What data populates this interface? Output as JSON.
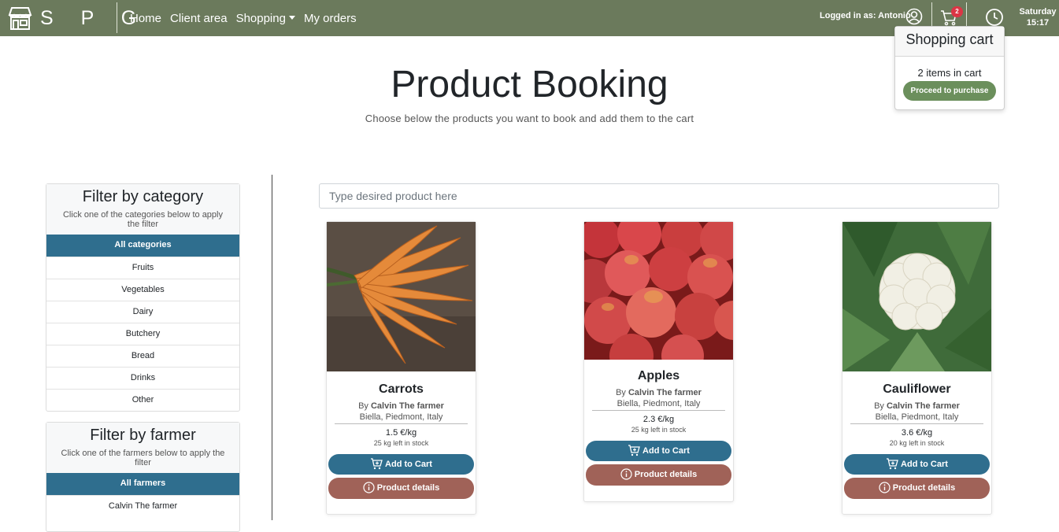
{
  "navbar": {
    "brand": "S P G",
    "links": [
      "Home",
      "Client area",
      "Shopping",
      "My orders"
    ],
    "logged_in": "Logged in as: Antonio",
    "cart_count": "2",
    "day": "Saturday",
    "time": "15:17"
  },
  "cart_popover": {
    "title": "Shopping cart",
    "count_text": "2 items in cart",
    "proceed_label": "Proceed to purchase"
  },
  "header": {
    "title": "Product Booking",
    "subtitle": "Choose below the products you want to book and add them to the cart"
  },
  "category_filter": {
    "title": "Filter by category",
    "hint": "Click one of the categories below to apply the filter",
    "items": [
      "All categories",
      "Fruits",
      "Vegetables",
      "Dairy",
      "Butchery",
      "Bread",
      "Drinks",
      "Other"
    ]
  },
  "farmer_filter": {
    "title": "Filter by farmer",
    "hint": "Click one of the farmers below to apply the filter",
    "items": [
      "All farmers",
      "Calvin The farmer"
    ]
  },
  "search": {
    "placeholder": "Type desired product here"
  },
  "products": [
    {
      "name": "Carrots",
      "by": "By",
      "farmer": "Calvin The farmer",
      "location": "Biella, Piedmont, Italy",
      "price": "1.5 €/kg",
      "stock": "25 kg left in stock",
      "add_label": "Add to Cart",
      "details_label": "Product details"
    },
    {
      "name": "Apples",
      "by": "By",
      "farmer": "Calvin The farmer",
      "location": "Biella, Piedmont, Italy",
      "price": "2.3 €/kg",
      "stock": "25 kg left in stock",
      "add_label": "Add to Cart",
      "details_label": "Product details"
    },
    {
      "name": "Cauliflower",
      "by": "By",
      "farmer": "Calvin The farmer",
      "location": "Biella, Piedmont, Italy",
      "price": "3.6 €/kg",
      "stock": "20 kg left in stock",
      "add_label": "Add to Cart",
      "details_label": "Product details"
    }
  ],
  "colors": {
    "navbar": "#6b7a5c",
    "primary": "#2f6e8e",
    "details": "#a06258",
    "proceed": "#6b8f5c",
    "badge": "#dc3545"
  },
  "icons": [
    "store-icon",
    "user-icon",
    "cart-icon",
    "clock-icon",
    "add-cart-icon",
    "info-icon",
    "caret-down-icon"
  ]
}
